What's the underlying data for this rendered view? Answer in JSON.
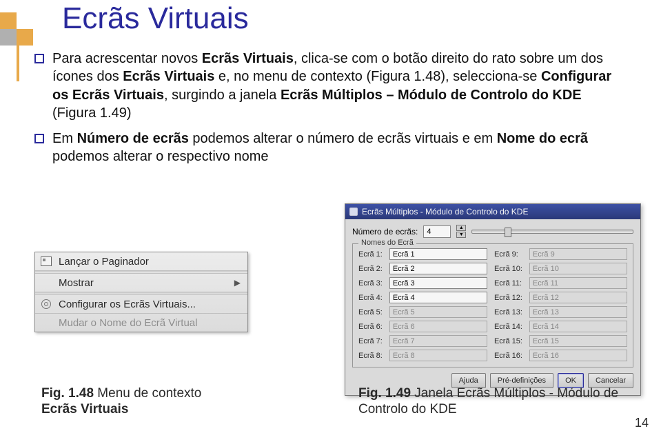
{
  "title": "Ecrãs Virtuais",
  "bullets": [
    {
      "pre": "Para acrescentar novos ",
      "b1": "Ecrãs Virtuais",
      "mid1": ", clica-se com o botão direito do rato sobre um dos ícones dos ",
      "b2": "Ecrãs Virtuais",
      "mid2": " e, no menu de contexto (Figura 1.48), selecciona-se ",
      "b3": "Configurar os Ecrãs Virtuais",
      "mid3": ", surgindo a janela ",
      "b4": "Ecrãs Múltiplos – Módulo de Controlo do KDE",
      "post": " (Figura 1.49)"
    },
    {
      "pre": "Em ",
      "b1": "Número de ecrãs",
      "mid1": " podemos alterar o número de ecrãs virtuais e em ",
      "b2": "Nome do ecrã",
      "mid2": " podemos alterar o respectivo nome",
      "b3": "",
      "mid3": "",
      "b4": "",
      "post": ""
    }
  ],
  "ctx": {
    "item1": "Lançar o Paginador",
    "item2": "Mostrar",
    "item3": "Configurar os Ecrãs Virtuais...",
    "item4": "Mudar o Nome do Ecrã Virtual"
  },
  "kde": {
    "title": "Ecrãs Múltiplos - Módulo de Controlo do KDE",
    "num_label": "Número de ecrãs:",
    "num_value": "4",
    "group_title": "Nomes do Ecrã",
    "rows": [
      {
        "l": "Ecrã 1:",
        "lv": "Ecrã 1",
        "r": "Ecrã 9:",
        "rv": "Ecrã 9"
      },
      {
        "l": "Ecrã 2:",
        "lv": "Ecrã 2",
        "r": "Ecrã 10:",
        "rv": "Ecrã 10"
      },
      {
        "l": "Ecrã 3:",
        "lv": "Ecrã 3",
        "r": "Ecrã 11:",
        "rv": "Ecrã 11"
      },
      {
        "l": "Ecrã 4:",
        "lv": "Ecrã 4",
        "r": "Ecrã 12:",
        "rv": "Ecrã 12"
      },
      {
        "l": "Ecrã 5:",
        "lv": "Ecrã 5",
        "r": "Ecrã 13:",
        "rv": "Ecrã 13"
      },
      {
        "l": "Ecrã 6:",
        "lv": "Ecrã 6",
        "r": "Ecrã 14:",
        "rv": "Ecrã 14"
      },
      {
        "l": "Ecrã 7:",
        "lv": "Ecrã 7",
        "r": "Ecrã 15:",
        "rv": "Ecrã 15"
      },
      {
        "l": "Ecrã 8:",
        "lv": "Ecrã 8",
        "r": "Ecrã 16:",
        "rv": "Ecrã 16"
      }
    ],
    "btn_help": "Ajuda",
    "btn_defaults": "Pré-definições",
    "btn_ok": "OK",
    "btn_cancel": "Cancelar"
  },
  "captions": {
    "left_a": "Fig. 1.48",
    "left_b": " Menu de contexto ",
    "left_c": "Ecrãs Virtuais",
    "right_a": "Fig. 1.49",
    "right_b": " Janela Ecrãs Múltiplos - Módulo de Controlo do KDE"
  },
  "page_num": "14"
}
